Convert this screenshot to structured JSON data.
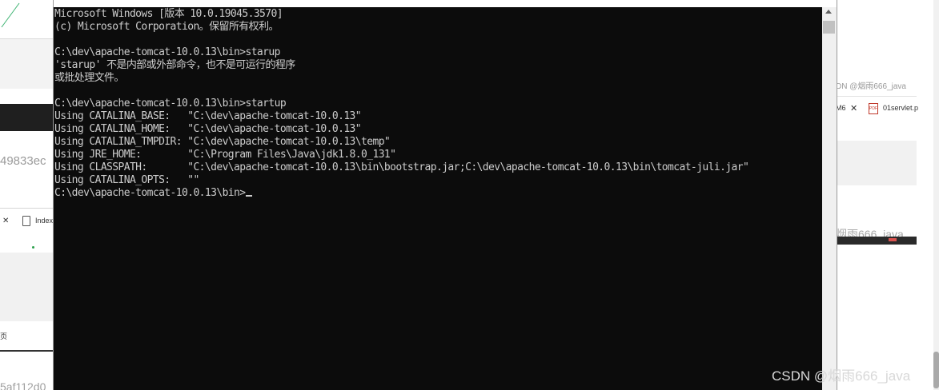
{
  "console": {
    "lines": [
      "Microsoft Windows [版本 10.0.19045.3570]",
      "(c) Microsoft Corporation。保留所有权利。",
      "",
      "C:\\dev\\apache-tomcat-10.0.13\\bin>starup",
      "'starup' 不是内部或外部命令，也不是可运行的程序",
      "或批处理文件。",
      "",
      "C:\\dev\\apache-tomcat-10.0.13\\bin>startup",
      "Using CATALINA_BASE:   \"C:\\dev\\apache-tomcat-10.0.13\"",
      "Using CATALINA_HOME:   \"C:\\dev\\apache-tomcat-10.0.13\"",
      "Using CATALINA_TMPDIR: \"C:\\dev\\apache-tomcat-10.0.13\\temp\"",
      "Using JRE_HOME:        \"C:\\Program Files\\Java\\jdk1.8.0_131\"",
      "Using CLASSPATH:       \"C:\\dev\\apache-tomcat-10.0.13\\bin\\bootstrap.jar;C:\\dev\\apache-tomcat-10.0.13\\bin\\tomcat-juli.jar\"",
      "Using CATALINA_OPTS:   \"\""
    ],
    "prompt": "C:\\dev\\apache-tomcat-10.0.13\\bin>"
  },
  "background": {
    "left": {
      "hash_text": "49833ec",
      "tab_label": "Index",
      "small_char": "页",
      "hash_bottom": "5af112d0"
    },
    "right": {
      "user_top": "DN @烟雨666_java",
      "tab_label": "M6",
      "pdf_label": "PDF",
      "tab_file": "01servlet.p",
      "user_mid": "烟雨666_java"
    }
  },
  "watermark": "CSDN @烟雨666_java",
  "colors": {
    "console_bg": "#0c0c0c",
    "console_fg": "#cccccc"
  }
}
